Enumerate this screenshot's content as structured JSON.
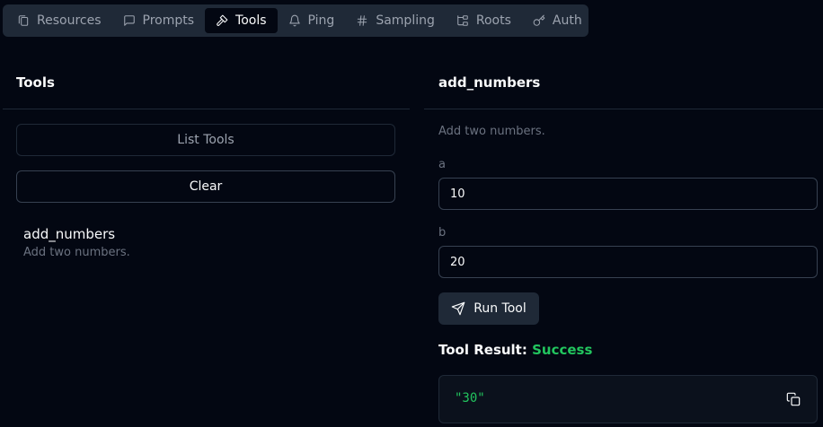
{
  "tabs": [
    {
      "label": "Resources",
      "icon": "files-icon"
    },
    {
      "label": "Prompts",
      "icon": "message-square-icon"
    },
    {
      "label": "Tools",
      "icon": "hammer-icon",
      "active": true
    },
    {
      "label": "Ping",
      "icon": "bell-icon"
    },
    {
      "label": "Sampling",
      "icon": "hash-icon"
    },
    {
      "label": "Roots",
      "icon": "folder-tree-icon"
    },
    {
      "label": "Auth",
      "icon": "key-icon"
    }
  ],
  "left": {
    "title": "Tools",
    "list_button": "List Tools",
    "clear_button": "Clear",
    "tools": [
      {
        "name": "add_numbers",
        "description": "Add two numbers."
      }
    ]
  },
  "right": {
    "title": "add_numbers",
    "description": "Add two numbers.",
    "fields": [
      {
        "label": "a",
        "value": "10"
      },
      {
        "label": "b",
        "value": "20"
      }
    ],
    "run_button": "Run Tool",
    "result": {
      "label": "Tool Result:",
      "status": "Success",
      "value": "\"30\""
    }
  },
  "colors": {
    "background": "#030712",
    "surface": "#1f2937",
    "success": "#22c55e",
    "muted": "#6b7280"
  }
}
